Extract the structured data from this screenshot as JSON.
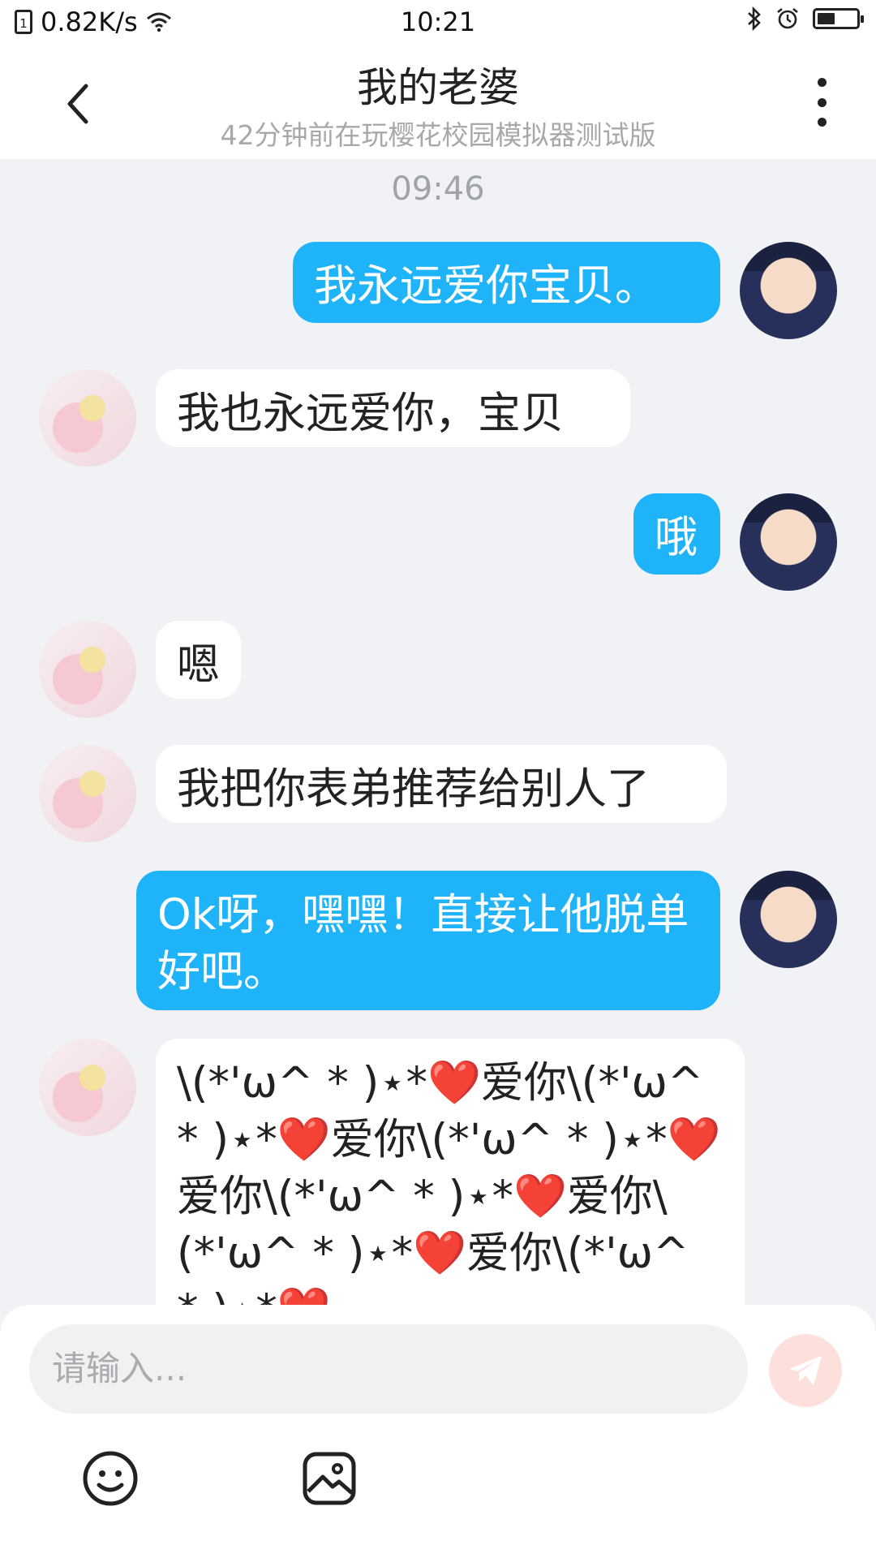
{
  "status_bar": {
    "network_speed": "0.82K/s",
    "time": "10:21",
    "battery_level": 0.45,
    "icons": [
      "sim-icon",
      "wifi-icon",
      "bluetooth-icon",
      "alarm-icon",
      "battery-icon"
    ]
  },
  "header": {
    "title": "我的老婆",
    "subtitle": "42分钟前在玩樱花校园模拟器测试版"
  },
  "chat": {
    "timestamp": "09:46",
    "messages": [
      {
        "sender": "me",
        "text": "我永远爱你宝贝。"
      },
      {
        "sender": "her",
        "text": "我也永远爱你，宝贝"
      },
      {
        "sender": "me",
        "text": "哦"
      },
      {
        "sender": "her",
        "text": "嗯"
      },
      {
        "sender": "her",
        "text": "我把你表弟推荐给别人了"
      },
      {
        "sender": "me",
        "text": "Ok呀，嘿嘿！直接让他脱单好吧。"
      },
      {
        "sender": "her",
        "text": "\\(*'ω^ * )⋆*❤️爱你\\(*'ω^ * )⋆*❤️爱你\\(*'ω^ * )⋆*❤️爱你\\(*'ω^ * )⋆*❤️爱你\\(*'ω^ * )⋆*❤️爱你\\(*'ω^ * )⋆*❤️"
      }
    ]
  },
  "input": {
    "placeholder": "请输入..."
  },
  "colors": {
    "accent": "#1fb4fa",
    "background": "#f0f2f5",
    "send_button": "#fde0dc"
  }
}
